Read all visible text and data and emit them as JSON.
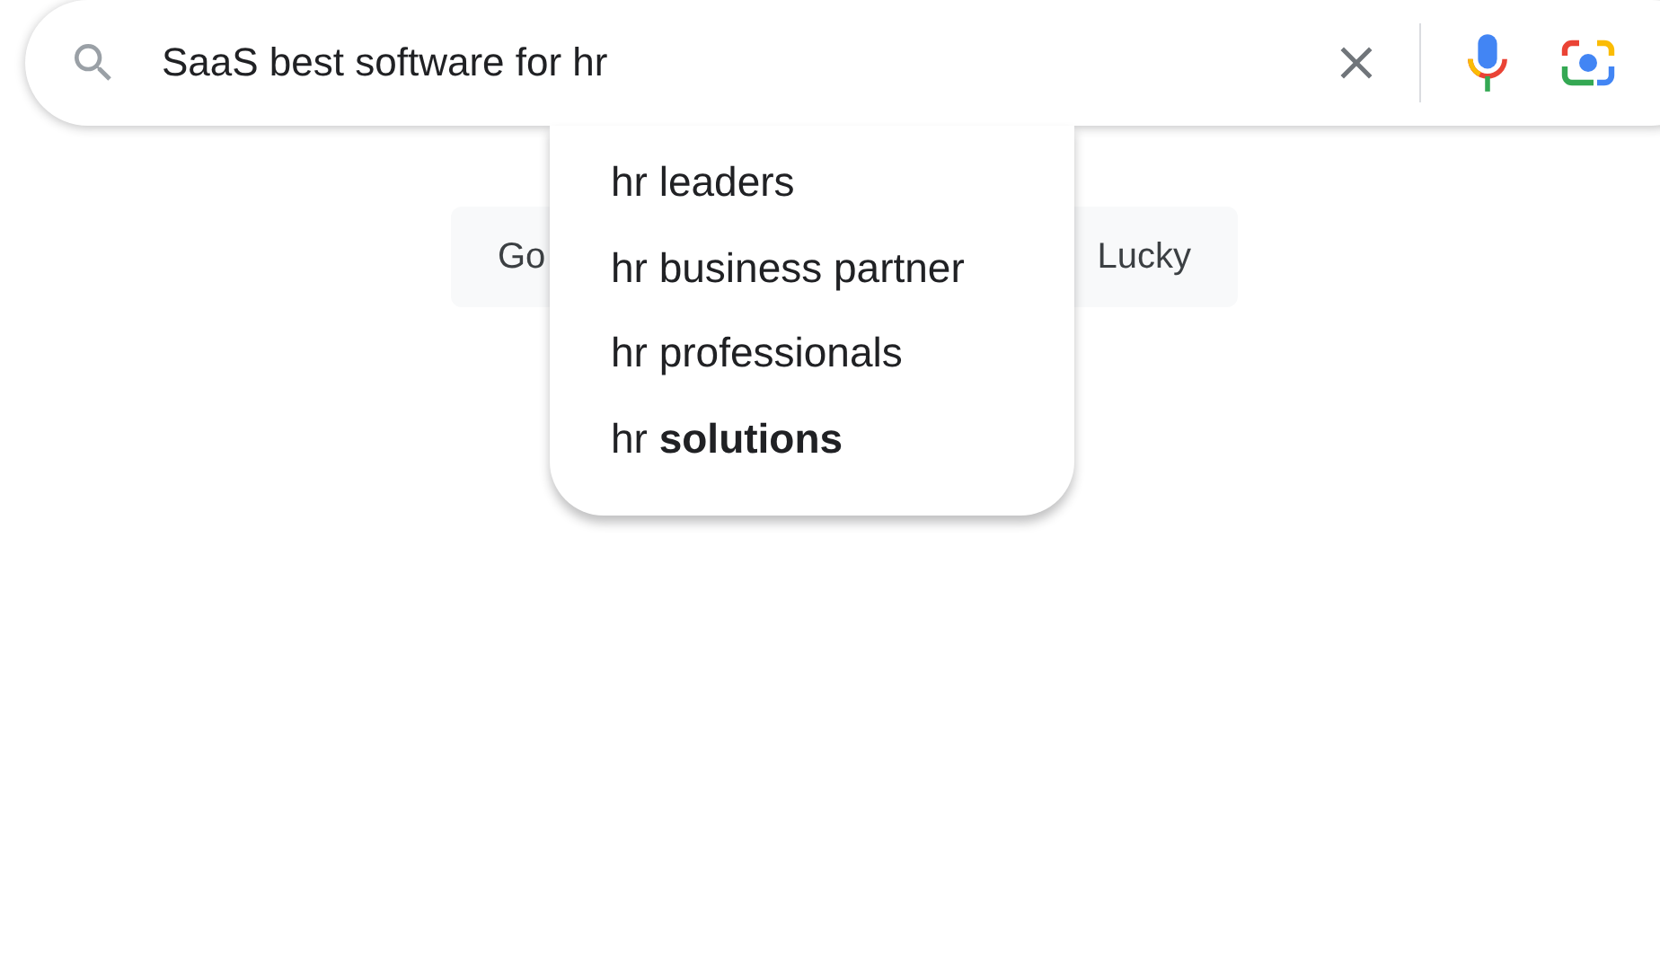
{
  "search": {
    "value": "SaaS best software for hr"
  },
  "buttons": [
    {
      "label": "Go"
    },
    {
      "label": "Lucky"
    }
  ],
  "suggestions": [
    {
      "text": "hr leaders"
    },
    {
      "text": "hr business partner"
    },
    {
      "text": "hr professionals"
    },
    {
      "text": "hr **solutions**"
    }
  ]
}
